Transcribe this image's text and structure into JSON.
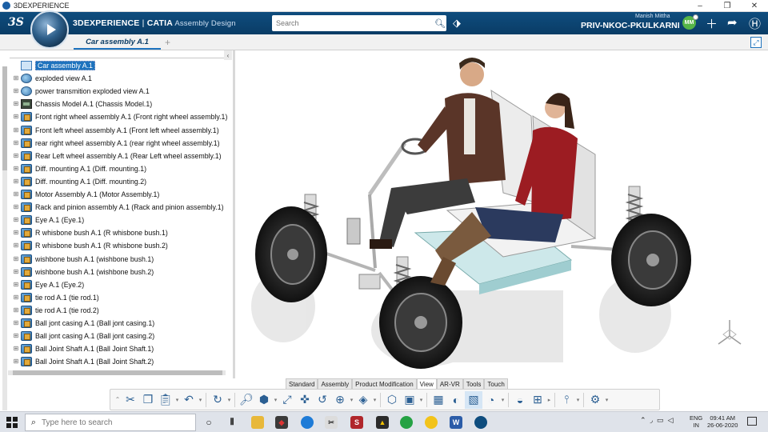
{
  "window": {
    "title": "3DEXPERIENCE",
    "controls": [
      "–",
      "❐",
      "✕"
    ]
  },
  "topbar": {
    "ds_logo": "3S",
    "brand_bold": "3DEXPERIENCE",
    "brand_sep": " | ",
    "brand_product": "CATIA",
    "brand_app": " Assembly Design",
    "search_placeholder": "Search",
    "user_name": "Manish Mittha",
    "tenant": "PRIV-NKOC-PKULKARNI",
    "avatar": "MM"
  },
  "tabs": {
    "active": "Car assembly A.1",
    "add": "+"
  },
  "tree": {
    "items": [
      {
        "label": "Car assembly A.1",
        "icon": "root-product-icon"
      },
      {
        "label": "exploded view A.1",
        "icon": "scene-icon"
      },
      {
        "label": "power transmition exploded view A.1",
        "icon": "scene-icon"
      },
      {
        "label": "Chassis Model A.1 (Chassis Model.1)",
        "icon": "chassis-icon"
      },
      {
        "label": "Front right wheel assembly A.1 (Front right wheel assembly.1)",
        "icon": "product-icon"
      },
      {
        "label": "Front left wheel assembly A.1 (Front left wheel assembly.1)",
        "icon": "product-icon"
      },
      {
        "label": "rear right wheel assembly A.1 (rear right wheel assembly.1)",
        "icon": "product-icon"
      },
      {
        "label": "Rear Left wheel assembly A.1 (Rear Left wheel assembly.1)",
        "icon": "product-icon"
      },
      {
        "label": "Diff. mounting A.1 (Diff. mounting.1)",
        "icon": "product-icon"
      },
      {
        "label": "Diff. mounting A.1 (Diff. mounting.2)",
        "icon": "product-icon"
      },
      {
        "label": "Motor Assembly A.1 (Motor Assembly.1)",
        "icon": "product-icon"
      },
      {
        "label": "Rack and pinion assembly A.1 (Rack and pinion assembly.1)",
        "icon": "product-icon"
      },
      {
        "label": "Eye A.1 (Eye.1)",
        "icon": "product-icon"
      },
      {
        "label": "R whisbone bush A.1 (R whisbone bush.1)",
        "icon": "product-icon"
      },
      {
        "label": "R whisbone bush A.1 (R whisbone bush.2)",
        "icon": "product-icon"
      },
      {
        "label": "wishbone bush A.1 (wishbone bush.1)",
        "icon": "product-icon"
      },
      {
        "label": "wishbone bush A.1 (wishbone bush.2)",
        "icon": "product-icon"
      },
      {
        "label": "Eye A.1 (Eye.2)",
        "icon": "product-icon"
      },
      {
        "label": "tie rod A.1 (tie rod.1)",
        "icon": "product-icon"
      },
      {
        "label": "tie rod A.1 (tie rod.2)",
        "icon": "product-icon"
      },
      {
        "label": "Ball jont casing A.1 (Ball jont casing.1)",
        "icon": "product-icon"
      },
      {
        "label": "Ball jont casing A.1 (Ball jont casing.2)",
        "icon": "product-icon"
      },
      {
        "label": "Ball Joint Shaft A.1 (Ball Joint Shaft.1)",
        "icon": "product-icon"
      },
      {
        "label": "Ball Joint Shaft A.1 (Ball Joint Shaft.2)",
        "icon": "product-icon"
      }
    ]
  },
  "section_tabs": [
    "Standard",
    "Assembly",
    "Product Modification",
    "View",
    "AR-VR",
    "Tools",
    "Touch"
  ],
  "active_section": "View",
  "taskbar": {
    "search_placeholder": "Type here to search",
    "lang_top": "ENG",
    "lang_bottom": "IN",
    "time": "09:41 AM",
    "date": "26-06-2020"
  },
  "colors": {
    "topbar": "#0a3c66",
    "accent": "#1e73be",
    "avatar": "#55b548"
  }
}
